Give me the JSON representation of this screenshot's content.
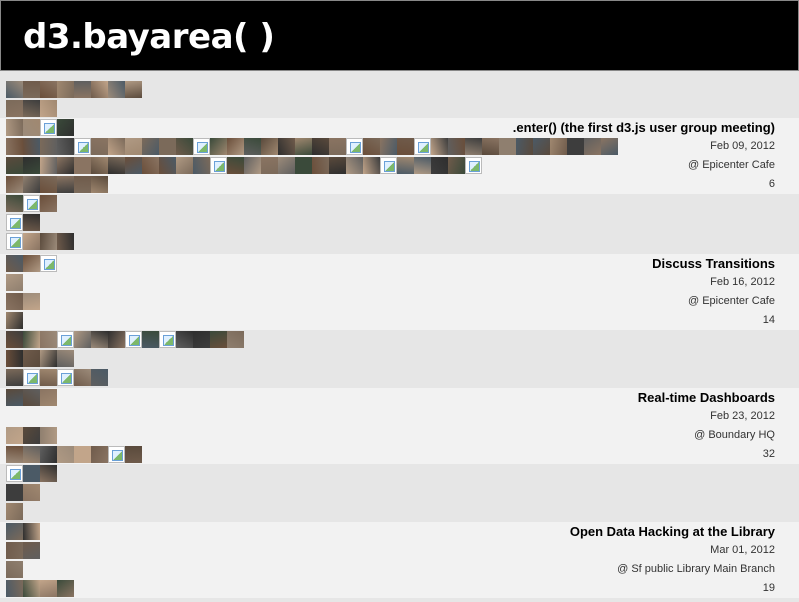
{
  "site": {
    "title": "d3.bayarea( )"
  },
  "events": [
    {
      "title": ".enter() (the first d3.js user group meeting)",
      "date": "Feb 09, 2012",
      "venue": "@ Epicenter Cafe",
      "attendees": "6"
    },
    {
      "title": "Discuss Transitions",
      "date": "Feb 16, 2012",
      "venue": "@ Epicenter Cafe",
      "attendees": "14"
    },
    {
      "title": "Real-time Dashboards",
      "date": "Feb 23, 2012",
      "venue": "@ Boundary HQ",
      "attendees": "32"
    },
    {
      "title": "Open Data Hacking at the Library",
      "date": "Mar 01, 2012",
      "venue": "@ Sf public Library Main Branch",
      "attendees": "19"
    }
  ],
  "colors": {
    "header_bg": "#000000",
    "header_text": "#ffffff",
    "page_bg": "#e6e6e6",
    "row_light": "#f2f2f2"
  }
}
